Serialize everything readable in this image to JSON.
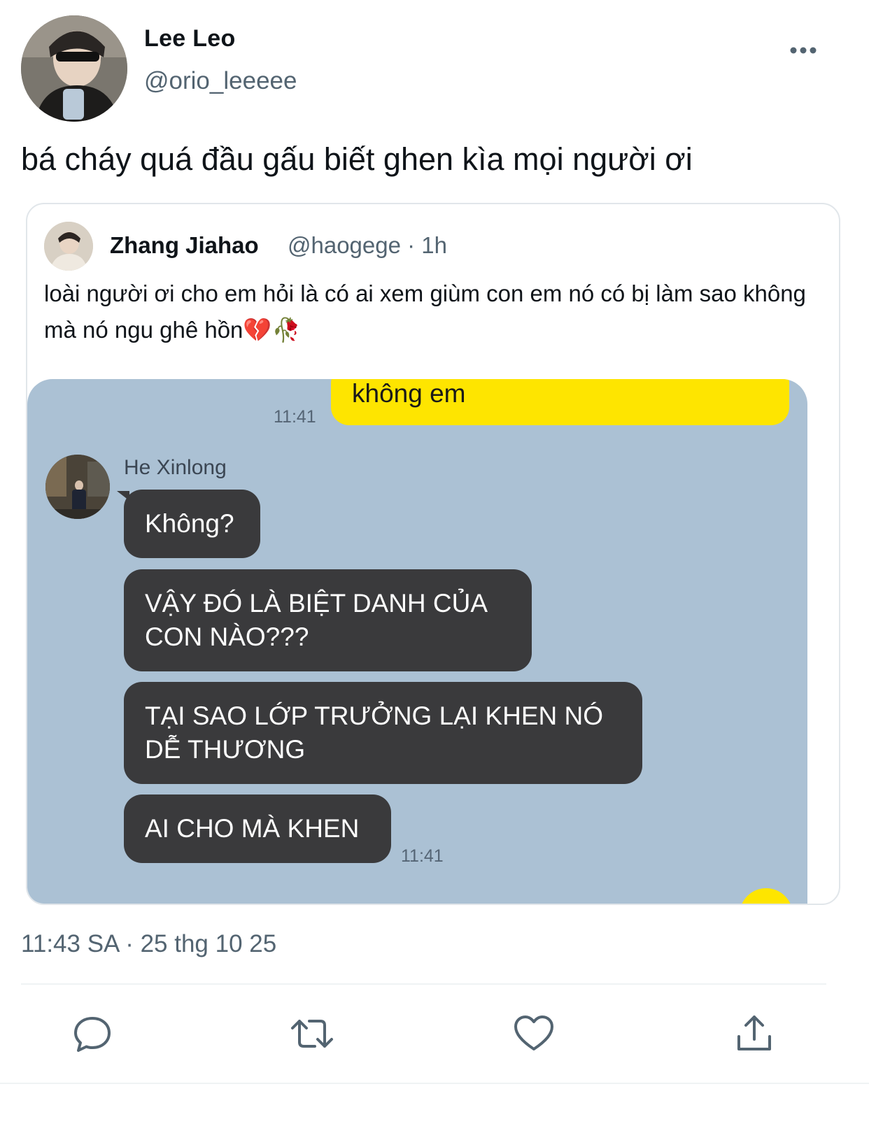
{
  "tweet": {
    "display_name": "Lee Leo",
    "handle": "@orio_leeeee",
    "text": "bá cháy quá đầu gấu biết ghen kìa mọi người ơi",
    "timestamp": "11:43 SA · 25 thg 10 25"
  },
  "quote": {
    "display_name": "Zhang Jiahao",
    "meta": "@haogege · 1h",
    "text": "loài người ơi cho em hỏi là có ai xem giùm con em nó có bị làm sao không mà nó ngu ghê hồn💔🥀"
  },
  "chat": {
    "sent_message": "không em",
    "time_top": "11:41",
    "sender_name": "He Xinlong",
    "messages": [
      "Không?",
      "VẬY ĐÓ LÀ BIỆT DANH CỦA CON NÀO???",
      "TẠI SAO LỚP TRƯỞNG LẠI KHEN NÓ DỄ THƯƠNG",
      "AI CHO MÀ KHEN"
    ],
    "time_bottom": "11:41",
    "colors": {
      "background": "#abc1d4",
      "sent_bubble": "#fee500",
      "received_bubble": "#3a3a3c"
    }
  },
  "icons": [
    "more-icon",
    "reply-icon",
    "retweet-icon",
    "like-icon",
    "share-icon"
  ]
}
